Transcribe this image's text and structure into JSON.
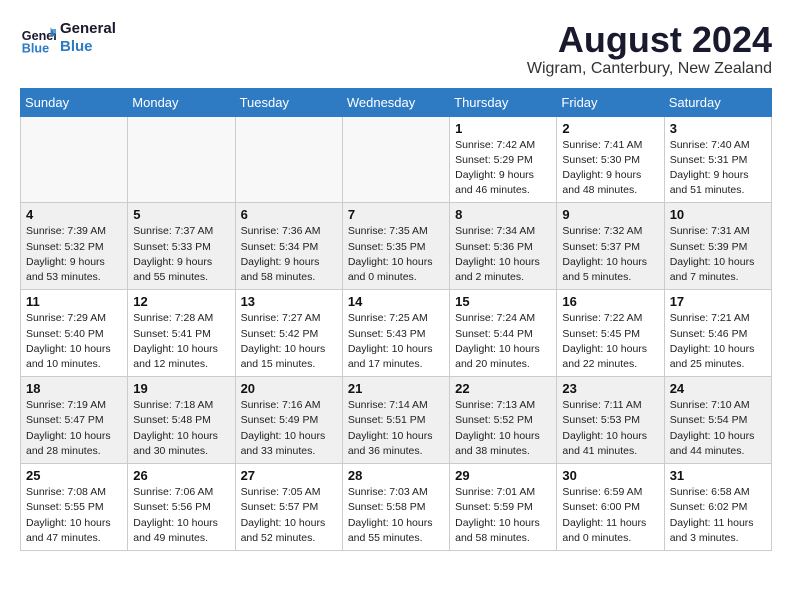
{
  "header": {
    "logo_line1": "General",
    "logo_line2": "Blue",
    "month_year": "August 2024",
    "location": "Wigram, Canterbury, New Zealand"
  },
  "weekdays": [
    "Sunday",
    "Monday",
    "Tuesday",
    "Wednesday",
    "Thursday",
    "Friday",
    "Saturday"
  ],
  "weeks": [
    [
      {
        "day": "",
        "info": ""
      },
      {
        "day": "",
        "info": ""
      },
      {
        "day": "",
        "info": ""
      },
      {
        "day": "",
        "info": ""
      },
      {
        "day": "1",
        "info": "Sunrise: 7:42 AM\nSunset: 5:29 PM\nDaylight: 9 hours\nand 46 minutes."
      },
      {
        "day": "2",
        "info": "Sunrise: 7:41 AM\nSunset: 5:30 PM\nDaylight: 9 hours\nand 48 minutes."
      },
      {
        "day": "3",
        "info": "Sunrise: 7:40 AM\nSunset: 5:31 PM\nDaylight: 9 hours\nand 51 minutes."
      }
    ],
    [
      {
        "day": "4",
        "info": "Sunrise: 7:39 AM\nSunset: 5:32 PM\nDaylight: 9 hours\nand 53 minutes."
      },
      {
        "day": "5",
        "info": "Sunrise: 7:37 AM\nSunset: 5:33 PM\nDaylight: 9 hours\nand 55 minutes."
      },
      {
        "day": "6",
        "info": "Sunrise: 7:36 AM\nSunset: 5:34 PM\nDaylight: 9 hours\nand 58 minutes."
      },
      {
        "day": "7",
        "info": "Sunrise: 7:35 AM\nSunset: 5:35 PM\nDaylight: 10 hours\nand 0 minutes."
      },
      {
        "day": "8",
        "info": "Sunrise: 7:34 AM\nSunset: 5:36 PM\nDaylight: 10 hours\nand 2 minutes."
      },
      {
        "day": "9",
        "info": "Sunrise: 7:32 AM\nSunset: 5:37 PM\nDaylight: 10 hours\nand 5 minutes."
      },
      {
        "day": "10",
        "info": "Sunrise: 7:31 AM\nSunset: 5:39 PM\nDaylight: 10 hours\nand 7 minutes."
      }
    ],
    [
      {
        "day": "11",
        "info": "Sunrise: 7:29 AM\nSunset: 5:40 PM\nDaylight: 10 hours\nand 10 minutes."
      },
      {
        "day": "12",
        "info": "Sunrise: 7:28 AM\nSunset: 5:41 PM\nDaylight: 10 hours\nand 12 minutes."
      },
      {
        "day": "13",
        "info": "Sunrise: 7:27 AM\nSunset: 5:42 PM\nDaylight: 10 hours\nand 15 minutes."
      },
      {
        "day": "14",
        "info": "Sunrise: 7:25 AM\nSunset: 5:43 PM\nDaylight: 10 hours\nand 17 minutes."
      },
      {
        "day": "15",
        "info": "Sunrise: 7:24 AM\nSunset: 5:44 PM\nDaylight: 10 hours\nand 20 minutes."
      },
      {
        "day": "16",
        "info": "Sunrise: 7:22 AM\nSunset: 5:45 PM\nDaylight: 10 hours\nand 22 minutes."
      },
      {
        "day": "17",
        "info": "Sunrise: 7:21 AM\nSunset: 5:46 PM\nDaylight: 10 hours\nand 25 minutes."
      }
    ],
    [
      {
        "day": "18",
        "info": "Sunrise: 7:19 AM\nSunset: 5:47 PM\nDaylight: 10 hours\nand 28 minutes."
      },
      {
        "day": "19",
        "info": "Sunrise: 7:18 AM\nSunset: 5:48 PM\nDaylight: 10 hours\nand 30 minutes."
      },
      {
        "day": "20",
        "info": "Sunrise: 7:16 AM\nSunset: 5:49 PM\nDaylight: 10 hours\nand 33 minutes."
      },
      {
        "day": "21",
        "info": "Sunrise: 7:14 AM\nSunset: 5:51 PM\nDaylight: 10 hours\nand 36 minutes."
      },
      {
        "day": "22",
        "info": "Sunrise: 7:13 AM\nSunset: 5:52 PM\nDaylight: 10 hours\nand 38 minutes."
      },
      {
        "day": "23",
        "info": "Sunrise: 7:11 AM\nSunset: 5:53 PM\nDaylight: 10 hours\nand 41 minutes."
      },
      {
        "day": "24",
        "info": "Sunrise: 7:10 AM\nSunset: 5:54 PM\nDaylight: 10 hours\nand 44 minutes."
      }
    ],
    [
      {
        "day": "25",
        "info": "Sunrise: 7:08 AM\nSunset: 5:55 PM\nDaylight: 10 hours\nand 47 minutes."
      },
      {
        "day": "26",
        "info": "Sunrise: 7:06 AM\nSunset: 5:56 PM\nDaylight: 10 hours\nand 49 minutes."
      },
      {
        "day": "27",
        "info": "Sunrise: 7:05 AM\nSunset: 5:57 PM\nDaylight: 10 hours\nand 52 minutes."
      },
      {
        "day": "28",
        "info": "Sunrise: 7:03 AM\nSunset: 5:58 PM\nDaylight: 10 hours\nand 55 minutes."
      },
      {
        "day": "29",
        "info": "Sunrise: 7:01 AM\nSunset: 5:59 PM\nDaylight: 10 hours\nand 58 minutes."
      },
      {
        "day": "30",
        "info": "Sunrise: 6:59 AM\nSunset: 6:00 PM\nDaylight: 11 hours\nand 0 minutes."
      },
      {
        "day": "31",
        "info": "Sunrise: 6:58 AM\nSunset: 6:02 PM\nDaylight: 11 hours\nand 3 minutes."
      }
    ]
  ]
}
